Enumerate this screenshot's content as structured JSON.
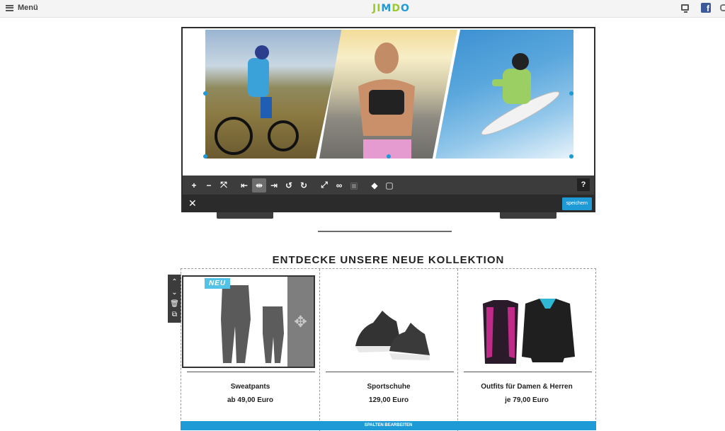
{
  "topbar": {
    "menu_label": "Menü",
    "logo": "JIMDO",
    "fb_letter": "f"
  },
  "gallery_editor": {
    "toolbar": {
      "help_label": "?"
    },
    "save_label": "speichern",
    "close_label": "✕"
  },
  "section": {
    "heading": "ENTDECKE UNSERE NEUE KOLLEKTION",
    "products": [
      {
        "name": "Sweatpants",
        "price": "ab 49,00 Euro",
        "badge": "NEU"
      },
      {
        "name": "Sportschuhe",
        "price": "129,00 Euro"
      },
      {
        "name": "Outfits für Damen & Herren",
        "price": "je 79,00 Euro"
      }
    ],
    "edit_columns_label": "SPALTEN BEARBEITEN"
  },
  "colors": {
    "accent": "#1e9ad6",
    "badge": "#52c3e6",
    "toolbar": "#3c3c3c"
  }
}
